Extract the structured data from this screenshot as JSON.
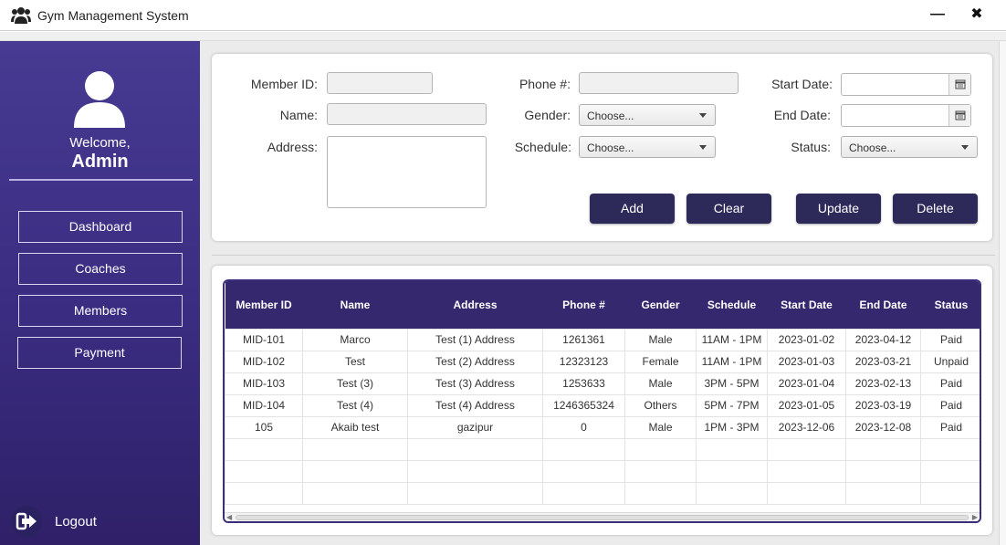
{
  "window": {
    "title": "Gym Management System"
  },
  "sidebar": {
    "welcome": "Welcome,",
    "user": "Admin",
    "nav": [
      {
        "label": "Dashboard"
      },
      {
        "label": "Coaches"
      },
      {
        "label": "Members"
      },
      {
        "label": "Payment"
      }
    ],
    "logout": "Logout"
  },
  "form": {
    "member_id_label": "Member ID:",
    "name_label": "Name:",
    "address_label": "Address:",
    "phone_label": "Phone #:",
    "gender_label": "Gender:",
    "schedule_label": "Schedule:",
    "start_date_label": "Start Date:",
    "end_date_label": "End Date:",
    "status_label": "Status:",
    "gender_value": "Choose...",
    "schedule_value": "Choose...",
    "status_value": "Choose...",
    "buttons": {
      "add": "Add",
      "clear": "Clear",
      "update": "Update",
      "delete": "Delete"
    }
  },
  "table": {
    "columns": [
      "Member ID",
      "Name",
      "Address",
      "Phone #",
      "Gender",
      "Schedule",
      "Start Date",
      "End Date",
      "Status"
    ],
    "rows": [
      [
        "MID-101",
        "Marco",
        "Test (1) Address",
        "1261361",
        "Male",
        "11AM - 1PM",
        "2023-01-02",
        "2023-04-12",
        "Paid"
      ],
      [
        "MID-102",
        "Test",
        "Test (2) Address",
        "12323123",
        "Female",
        "11AM - 1PM",
        "2023-01-03",
        "2023-03-21",
        "Unpaid"
      ],
      [
        "MID-103",
        "Test (3)",
        "Test (3) Address",
        "1253633",
        "Male",
        "3PM - 5PM",
        "2023-01-04",
        "2023-02-13",
        "Paid"
      ],
      [
        "MID-104",
        "Test (4)",
        "Test (4) Address",
        "1246365324",
        "Others",
        "5PM - 7PM",
        "2023-01-05",
        "2023-03-19",
        "Paid"
      ],
      [
        "105",
        "Akaib test",
        "gazipur",
        "0",
        "Male",
        "1PM - 3PM",
        "2023-12-06",
        "2023-12-08",
        "Paid"
      ]
    ]
  },
  "colors": {
    "sidebar_top": "#463a92",
    "sidebar_bottom": "#2f2068",
    "table_header": "#35286f",
    "button": "#2d2a5a"
  }
}
